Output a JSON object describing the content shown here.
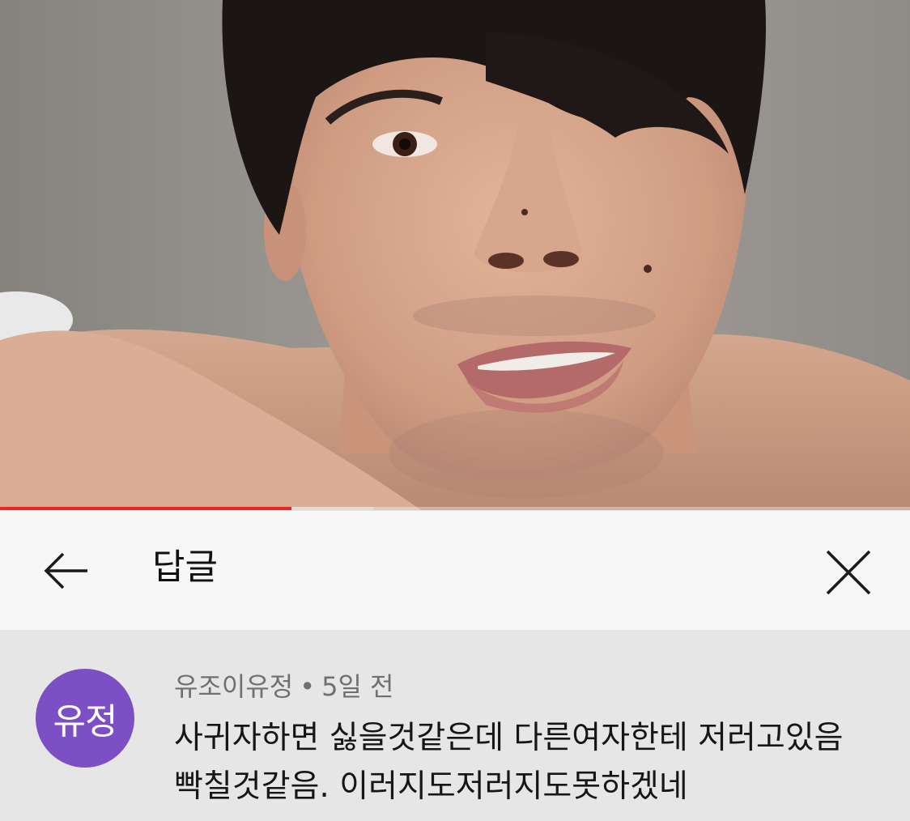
{
  "video": {
    "progress_played": 0.32,
    "progress_buffered": 0.41,
    "progress_color": "#e8281e"
  },
  "header": {
    "title": "답글",
    "back_icon": "arrow-left-icon",
    "close_icon": "close-icon"
  },
  "comment": {
    "avatar_text": "유정",
    "avatar_color": "#7d4fc4",
    "author": "유조이유정",
    "separator": "•",
    "time": "5일 전",
    "text_lines": [
      "사귀자하면 싫을것같은데 다른여자한테 저러고있음",
      "빡칠것같음. 이러지도저러지도못하겠네"
    ]
  }
}
